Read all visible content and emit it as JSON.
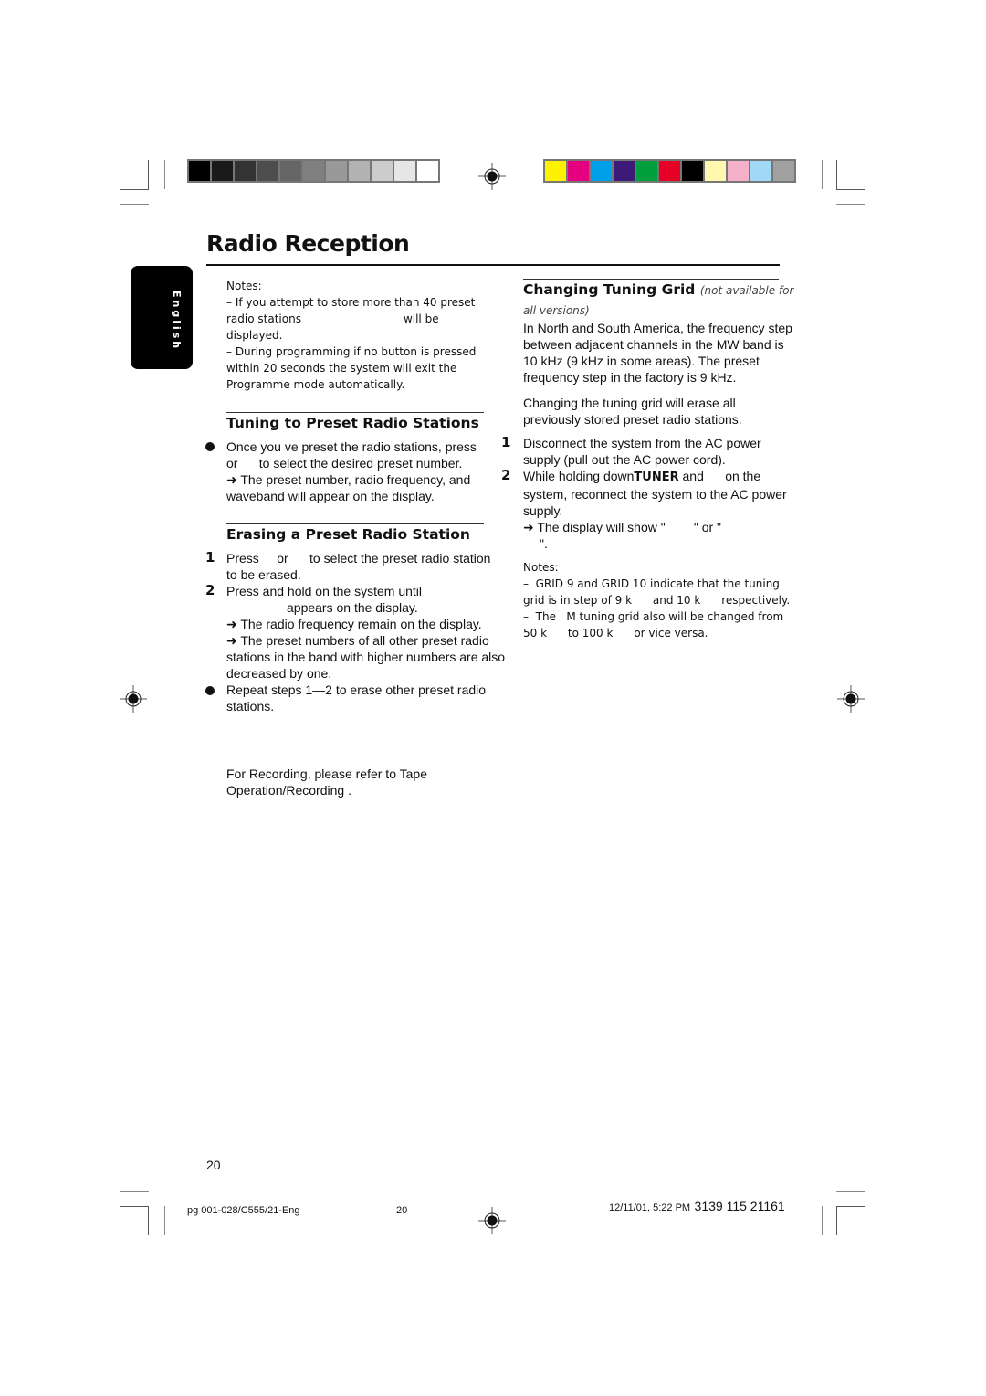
{
  "print_marks": {
    "grayscale_bar": [
      "#000000",
      "#1a1a1a",
      "#333333",
      "#4d4d4d",
      "#666666",
      "#808080",
      "#999999",
      "#b3b3b3",
      "#cccccc",
      "#e6e6e6",
      "#ffffff"
    ],
    "color_bar": [
      "#fff200",
      "#e4007f",
      "#00a0e9",
      "#3e1a78",
      "#009e3c",
      "#e60026",
      "#000000",
      "#fff9b0",
      "#f5b1c8",
      "#a0d8f5",
      "#a0a0a0"
    ]
  },
  "header": {
    "title": "Radio Reception",
    "language_tab": "English"
  },
  "left_column": {
    "notes": {
      "label": "Notes:",
      "items": [
        {
          "line1": "–  If you attempt to store more than 40 preset",
          "line2a": "radio stations",
          "line2b": "will be",
          "line3": "displayed."
        },
        {
          "line1": "–  During programming  if no button is pressed",
          "line2": "within 20 seconds  the system will exit the",
          "line3": "Programme mode automatically."
        }
      ]
    },
    "tuning_section": {
      "heading": "Tuning to Preset Radio Stations",
      "bullet_line1": "Once you ve preset the radio stations, press",
      "bullet_line2": "or      to select the desired preset number.",
      "result_line1": "➜ The preset number, radio frequency, and",
      "result_line2": "waveband will appear on the display."
    },
    "erasing_section": {
      "heading": "Erasing a Preset Radio Station",
      "steps": [
        {
          "num": "1",
          "line1": "Press     or      to select the preset radio station",
          "line2": "to be erased."
        },
        {
          "num": "2",
          "line1": "Press and hold  on the system until",
          "line2": "appears on the display."
        }
      ],
      "results": [
        "➜ The radio frequency remain on the display.",
        "➜ The preset numbers of all other preset radio",
        "stations in the band with higher numbers are also",
        "decreased by one."
      ],
      "repeat_line1": "Repeat steps 1—2 to erase other preset radio",
      "repeat_line2": "stations."
    },
    "recording_ref": {
      "line1": "For Recording, please refer to  Tape",
      "line2": "Operation/Recording ."
    }
  },
  "right_column": {
    "heading": "Changing Tuning Grid",
    "heading_sub": "(not available for",
    "heading_sub2": "all versions)",
    "para1": [
      "In North and South America, the frequency step",
      "between adjacent channels in the MW band is",
      "10 kHz (9 kHz in some areas). The preset",
      "frequency step in the factory is 9 kHz."
    ],
    "para2": [
      "Changing the tuning grid will erase all",
      "previously stored preset radio stations."
    ],
    "steps": [
      {
        "num": "1",
        "lines": [
          "Disconnect the system from the AC power",
          "supply (pull out the AC power cord)."
        ]
      },
      {
        "num": "2",
        "line1_pre": "While holding down",
        "line1_bold": "TUNER",
        "line1_post": " and      on the",
        "lines": [
          "system, reconnect the system to the AC power",
          "supply."
        ]
      }
    ],
    "result_line1": "➜ The display will show \"        \" or \"",
    "result_line2": "\".",
    "notes": {
      "label": "Notes:",
      "lines": [
        "–  GRID 9 and GRID 10 indicate that the tuning",
        "grid is in step of 9 k      and 10 k      respectively.",
        "–  The   M tuning grid also will be changed from",
        "50 k      to 100 k      or vice versa."
      ]
    }
  },
  "footer": {
    "page_number": "20",
    "file_ref": "pg 001-028/C555/21-Eng",
    "sheet_number": "20",
    "timestamp": "12/11/01, 5:22 PM",
    "part_number": "3139 115 21161"
  }
}
